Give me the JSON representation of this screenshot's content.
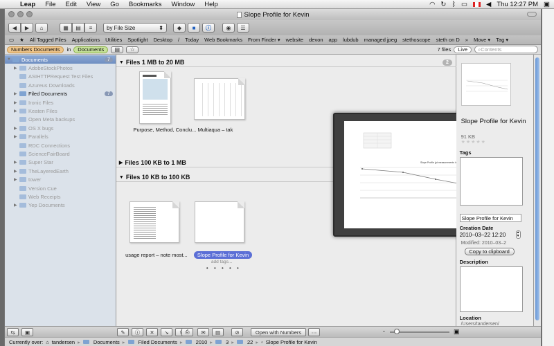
{
  "menubar": {
    "app": "Leap",
    "menus": [
      "File",
      "Edit",
      "View",
      "Go",
      "Bookmarks",
      "Window",
      "Help"
    ],
    "clock": "Thu 12:27 PM"
  },
  "window": {
    "title": "Slope Profile for Kevin"
  },
  "toolbar": {
    "sort_select": "by File Size"
  },
  "bookmarks": [
    "All Tagged Files",
    "Applications",
    "Utilities",
    "Spotlight",
    "Desktop",
    "/",
    "Today",
    "Web Bookmarks",
    "From Finder ▾",
    "website",
    "devon",
    "app",
    "lubdub",
    "managed jpeg",
    "stethoscope",
    "steth on D",
    "Move ▾",
    "Tag ▾"
  ],
  "filterbar": {
    "scope_token": "Numbers Documents",
    "in_label": "in",
    "location_token": "Documents",
    "file_count": "7 files",
    "live_label": "Live",
    "search_placeholder": "Contents"
  },
  "sidebar": {
    "items": [
      {
        "label": "Documents",
        "badge": "7"
      },
      {
        "label": "AdobeStockPhotos"
      },
      {
        "label": "ASIHTTPRequest Test Files"
      },
      {
        "label": "Azureus Downloads"
      },
      {
        "label": "Filed Documents",
        "badge": "7"
      },
      {
        "label": "Ironic Files"
      },
      {
        "label": "Keaten Files"
      },
      {
        "label": "Open Meta backups"
      },
      {
        "label": "OS X bugs"
      },
      {
        "label": "Parallels"
      },
      {
        "label": "RDC Connections"
      },
      {
        "label": "ScienceFairBoard"
      },
      {
        "label": "Super Star"
      },
      {
        "label": "TheLayeredEarth"
      },
      {
        "label": "tower"
      },
      {
        "label": "Version Cue"
      },
      {
        "label": "Web Receipts"
      },
      {
        "label": "Yep Documents"
      }
    ]
  },
  "groups": [
    {
      "title": "Files 1 MB to 20 MB",
      "count": "2"
    },
    {
      "title": "Files 100 KB to 1 MB",
      "count": "3"
    },
    {
      "title": "Files 10 KB to 100 KB",
      "count": "2"
    }
  ],
  "files": {
    "f1": "Purpose, Method, Conclu...",
    "f2": "Multiaqua – tak",
    "f3": "usage report – note most...",
    "f4": "Slope Profile for Kevin",
    "add_tags": "add tags...",
    "dots": "• • • • •"
  },
  "quicklook": {
    "chart_title": "Slope Profile (pt measurements in meters)"
  },
  "info": {
    "title": "Slope Profile for Kevin",
    "size": "91 KB",
    "tags_label": "Tags",
    "name_field": "Slope Profile for Kevin",
    "creation_label": "Creation Date",
    "creation_value": "2010–03–22 12:20",
    "modified": "Modified: 2010–03–2",
    "copy_button": "Copy to clipboard",
    "description_label": "Description",
    "location_label": "Location",
    "location_value": "/Users/tandersen/"
  },
  "bottombar": {
    "open_with": "Open with Numbers"
  },
  "pathbar": {
    "label": "Currently over:",
    "crumbs": [
      "tandersen",
      "Documents",
      "Filed Documents",
      "2010",
      "3",
      "22",
      "Slope Profile for Kevin"
    ]
  }
}
